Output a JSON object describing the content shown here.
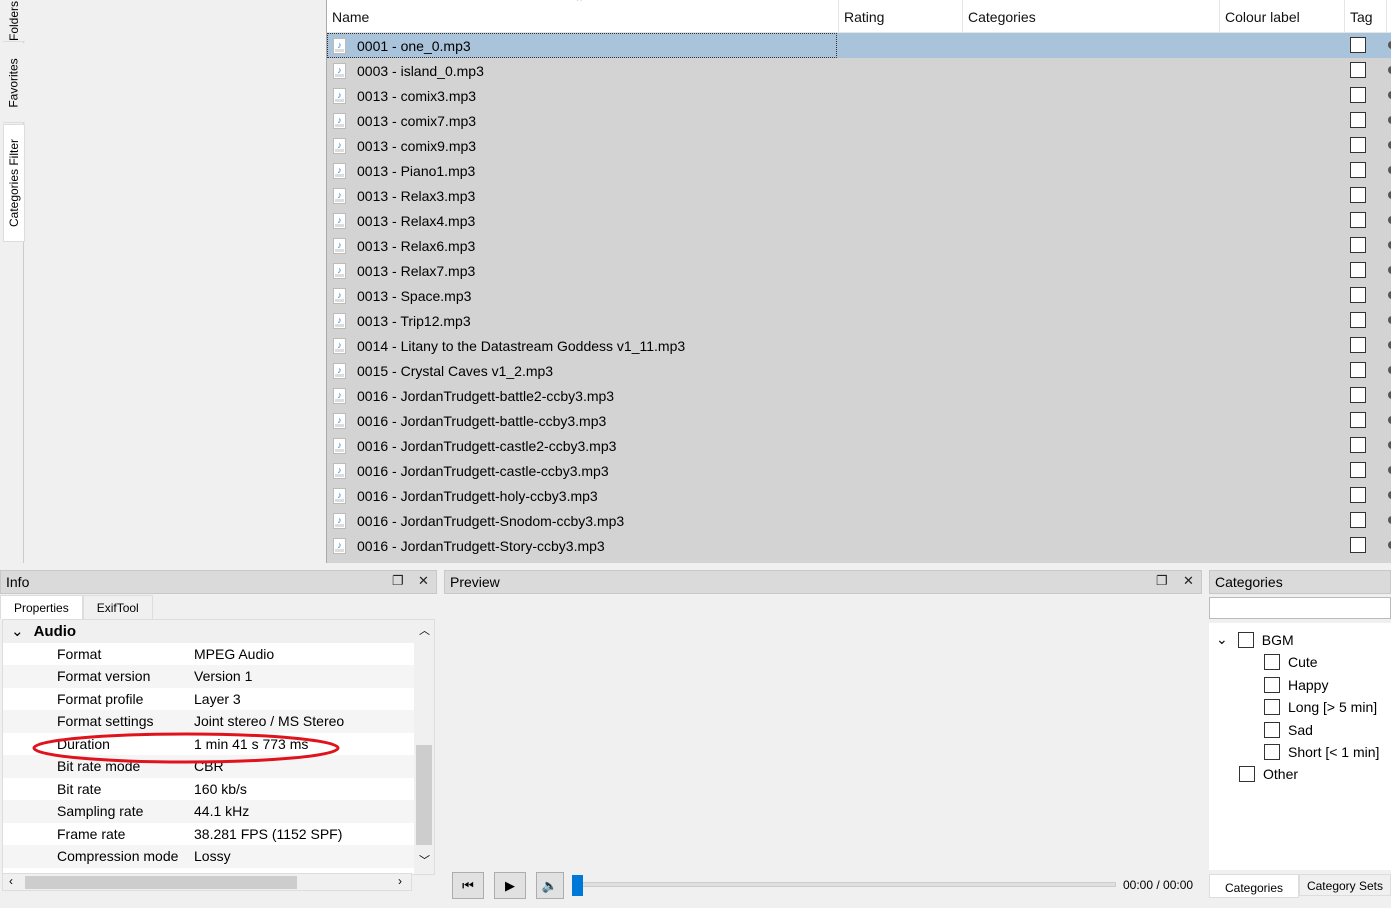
{
  "side_tabs": [
    "Folders",
    "Favorites",
    "Categories Filter"
  ],
  "columns": [
    "Name",
    "Rating",
    "Categories",
    "Colour label",
    "Tag"
  ],
  "files": [
    "0001 - one_0.mp3",
    "0003 - island_0.mp3",
    "0013 - comix3.mp3",
    "0013 - comix7.mp3",
    "0013 - comix9.mp3",
    "0013 - Piano1.mp3",
    "0013 - Relax3.mp3",
    "0013 - Relax4.mp3",
    "0013 - Relax6.mp3",
    "0013 - Relax7.mp3",
    "0013 - Space.mp3",
    "0013 - Trip12.mp3",
    "0014 - Litany to the Datastream Goddess v1_11.mp3",
    "0015 - Crystal Caves v1_2.mp3",
    "0016 - JordanTrudgett-battle2-ccby3.mp3",
    "0016 - JordanTrudgett-battle-ccby3.mp3",
    "0016 - JordanTrudgett-castle2-ccby3.mp3",
    "0016 - JordanTrudgett-castle-ccby3.mp3",
    "0016 - JordanTrudgett-holy-ccby3.mp3",
    "0016 - JordanTrudgett-Snodom-ccby3.mp3",
    "0016 - JordanTrudgett-Story-ccby3.mp3"
  ],
  "info": {
    "title": "Info",
    "tabs": [
      "Properties",
      "ExifTool"
    ],
    "group": "Audio",
    "props": [
      [
        "Format",
        "MPEG Audio"
      ],
      [
        "Format version",
        "Version 1"
      ],
      [
        "Format profile",
        "Layer 3"
      ],
      [
        "Format settings",
        "Joint stereo / MS Stereo"
      ],
      [
        "Duration",
        "1 min 41 s 773 ms"
      ],
      [
        "Bit rate mode",
        "CBR"
      ],
      [
        "Bit rate",
        "160 kb/s"
      ],
      [
        "Sampling rate",
        "44.1 kHz"
      ],
      [
        "Frame rate",
        "38.281 FPS (1152 SPF)"
      ],
      [
        "Compression mode",
        "Lossy"
      ]
    ]
  },
  "preview": {
    "title": "Preview",
    "time": "00:00 / 00:00",
    "progress": 0
  },
  "categories": {
    "title": "Categories",
    "search": "",
    "root": "BGM",
    "children": [
      "Cute",
      "Happy",
      "Long [> 5 min]",
      "Sad",
      "Short [< 1 min]"
    ],
    "other": "Other",
    "tabs": [
      "Categories",
      "Category Sets"
    ]
  },
  "colors": {
    "selected": "#a9c3da",
    "annotation": "#e0121c",
    "accent": "#0078d7"
  }
}
